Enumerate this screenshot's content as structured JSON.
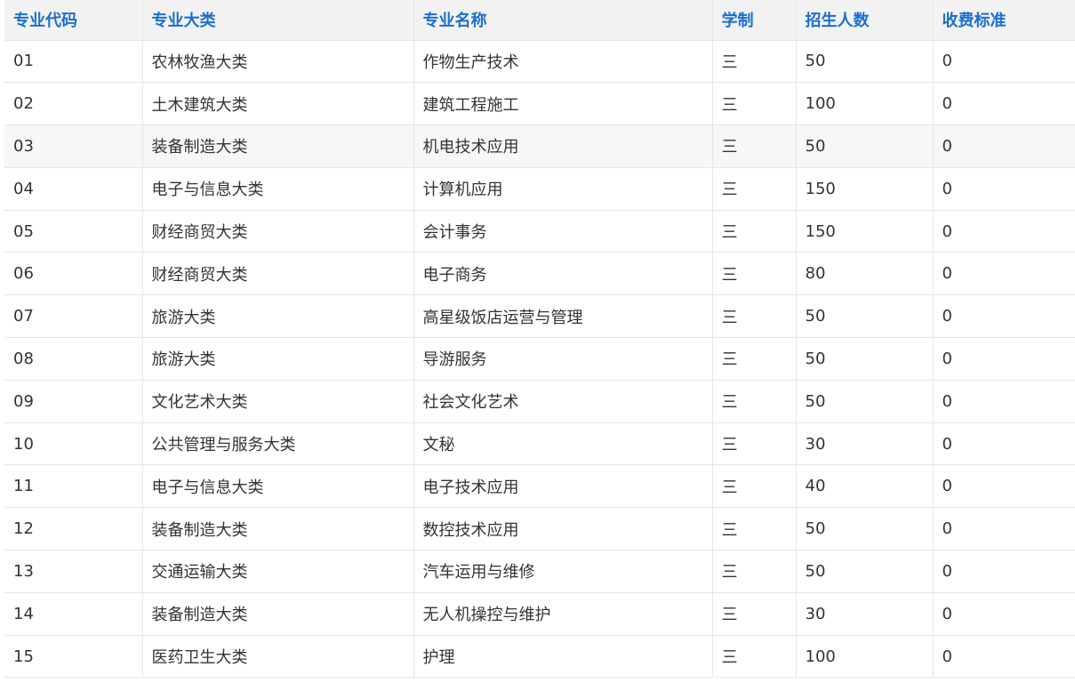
{
  "table": {
    "headers": [
      "专业代码",
      "专业大类",
      "专业名称",
      "学制",
      "招生人数",
      "收费标准"
    ],
    "rows": [
      [
        "01",
        "农林牧渔大类",
        "作物生产技术",
        "三",
        "50",
        "0"
      ],
      [
        "02",
        "土木建筑大类",
        "建筑工程施工",
        "三",
        "100",
        "0"
      ],
      [
        "03",
        "装备制造大类",
        "机电技术应用",
        "三",
        "50",
        "0"
      ],
      [
        "04",
        "电子与信息大类",
        "计算机应用",
        "三",
        "150",
        "0"
      ],
      [
        "05",
        "财经商贸大类",
        "会计事务",
        "三",
        "150",
        "0"
      ],
      [
        "06",
        "财经商贸大类",
        "电子商务",
        "三",
        "80",
        "0"
      ],
      [
        "07",
        "旅游大类",
        "高星级饭店运营与管理",
        "三",
        "50",
        "0"
      ],
      [
        "08",
        "旅游大类",
        "导游服务",
        "三",
        "50",
        "0"
      ],
      [
        "09",
        "文化艺术大类",
        "社会文化艺术",
        "三",
        "50",
        "0"
      ],
      [
        "10",
        "公共管理与服务大类",
        "文秘",
        "三",
        "30",
        "0"
      ],
      [
        "11",
        "电子与信息大类",
        "电子技术应用",
        "三",
        "40",
        "0"
      ],
      [
        "12",
        "装备制造大类",
        "数控技术应用",
        "三",
        "50",
        "0"
      ],
      [
        "13",
        "交通运输大类",
        "汽车运用与维修",
        "三",
        "50",
        "0"
      ],
      [
        "14",
        "装备制造大类",
        "无人机操控与维护",
        "三",
        "30",
        "0"
      ],
      [
        "15",
        "医药卫生大类",
        "护理",
        "三",
        "100",
        "0"
      ]
    ]
  },
  "colors": {
    "header_text": "#1a6fce",
    "header_bg": "#f2f2f2",
    "border": "#e6e6e6",
    "hover_row_bg": "#f7f7f7",
    "body_text": "#333333"
  }
}
